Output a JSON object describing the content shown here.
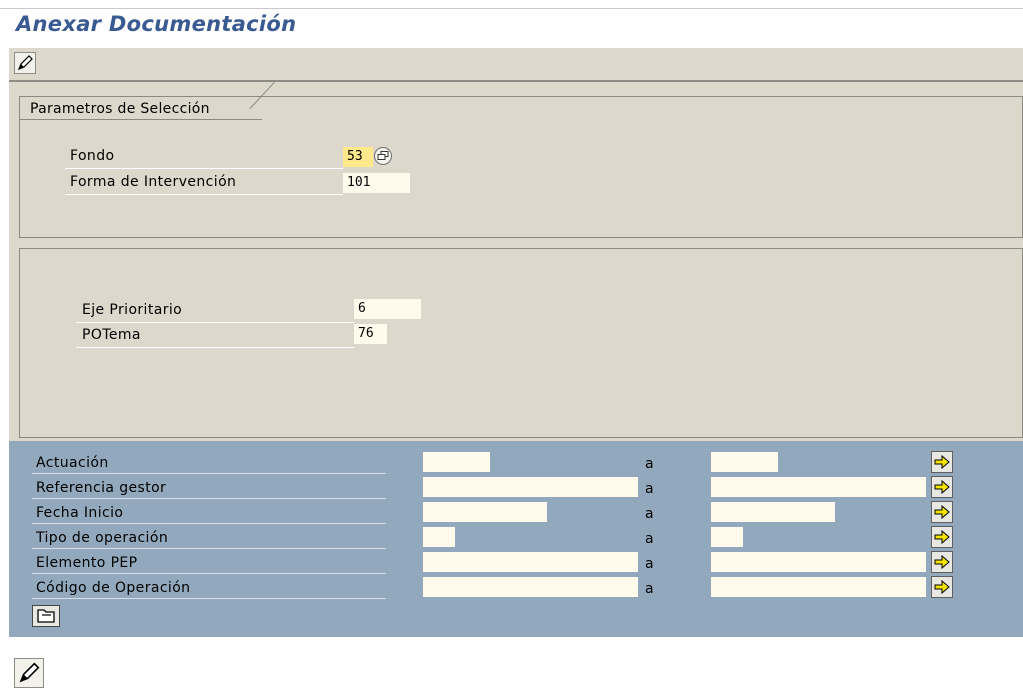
{
  "window": {
    "title": "Anexar Documentación"
  },
  "toolbar": {
    "edit_icon": "pencil-icon"
  },
  "selection": {
    "frame_title": "Parametros de Selección",
    "fondo": {
      "label": "Fondo",
      "value": "53"
    },
    "forma": {
      "label": "Forma de Intervención",
      "value": "101"
    }
  },
  "details": {
    "eje": {
      "label": "Eje Prioritario",
      "value": "6"
    },
    "potema": {
      "label": "POTema",
      "value": "76"
    }
  },
  "ranges": {
    "to_label": "a",
    "rows": [
      {
        "label": "Actuación",
        "from": "",
        "to": ""
      },
      {
        "label": "Referencia gestor",
        "from": "",
        "to": ""
      },
      {
        "label": "Fecha Inicio",
        "from": "",
        "to": ""
      },
      {
        "label": "Tipo de operación",
        "from": "",
        "to": ""
      },
      {
        "label": "Elemento PEP",
        "from": "",
        "to": ""
      },
      {
        "label": "Código de Operación",
        "from": "",
        "to": ""
      }
    ]
  },
  "colors": {
    "title_blue": "#3a5a92",
    "panel_bg": "#dcd9cc",
    "range_bg": "#92a9bd",
    "field_bg": "#fffbec",
    "focus_bg": "#ffe98a",
    "arrow_yellow": "#f5e400"
  }
}
